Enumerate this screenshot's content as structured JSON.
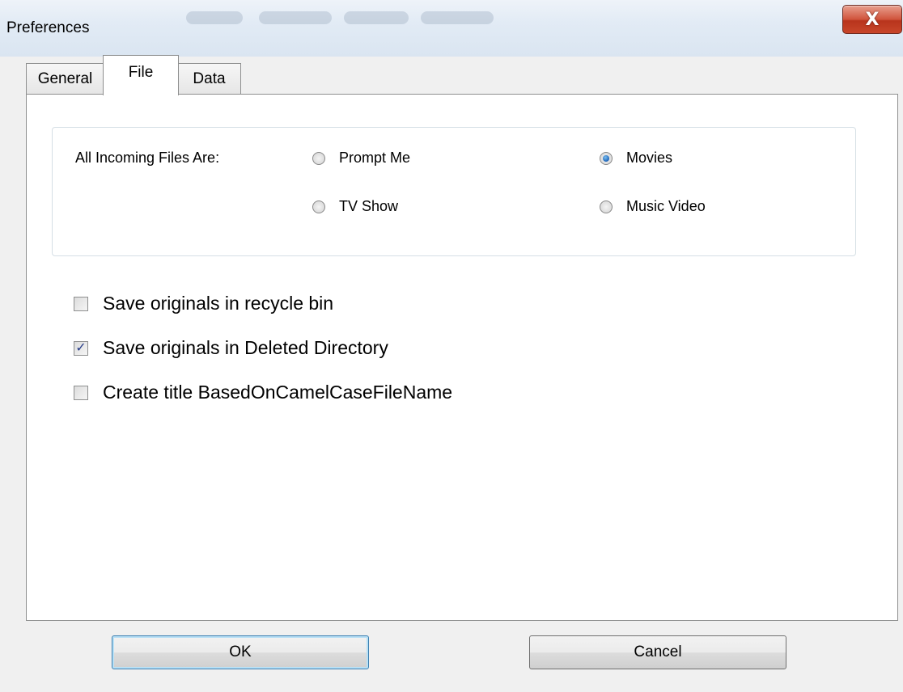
{
  "window": {
    "title": "Preferences",
    "close_glyph": "X"
  },
  "tabs": [
    {
      "label": "General",
      "selected": false
    },
    {
      "label": "File",
      "selected": true
    },
    {
      "label": "Data",
      "selected": false
    }
  ],
  "incoming_group": {
    "label": "All Incoming Files Are:",
    "options": [
      {
        "label": "Prompt Me",
        "selected": false
      },
      {
        "label": "Movies",
        "selected": true
      },
      {
        "label": "TV Show",
        "selected": false
      },
      {
        "label": "Music Video",
        "selected": false
      }
    ]
  },
  "checkboxes": [
    {
      "label": "Save originals in recycle bin",
      "checked": false
    },
    {
      "label": "Save originals in Deleted Directory",
      "checked": true
    },
    {
      "label": "Create title BasedOnCamelCaseFileName",
      "checked": false
    }
  ],
  "buttons": {
    "ok_label": "OK",
    "cancel_label": "Cancel"
  },
  "colors": {
    "accent_blue": "#3c7fb1",
    "close_red": "#c8462a"
  }
}
